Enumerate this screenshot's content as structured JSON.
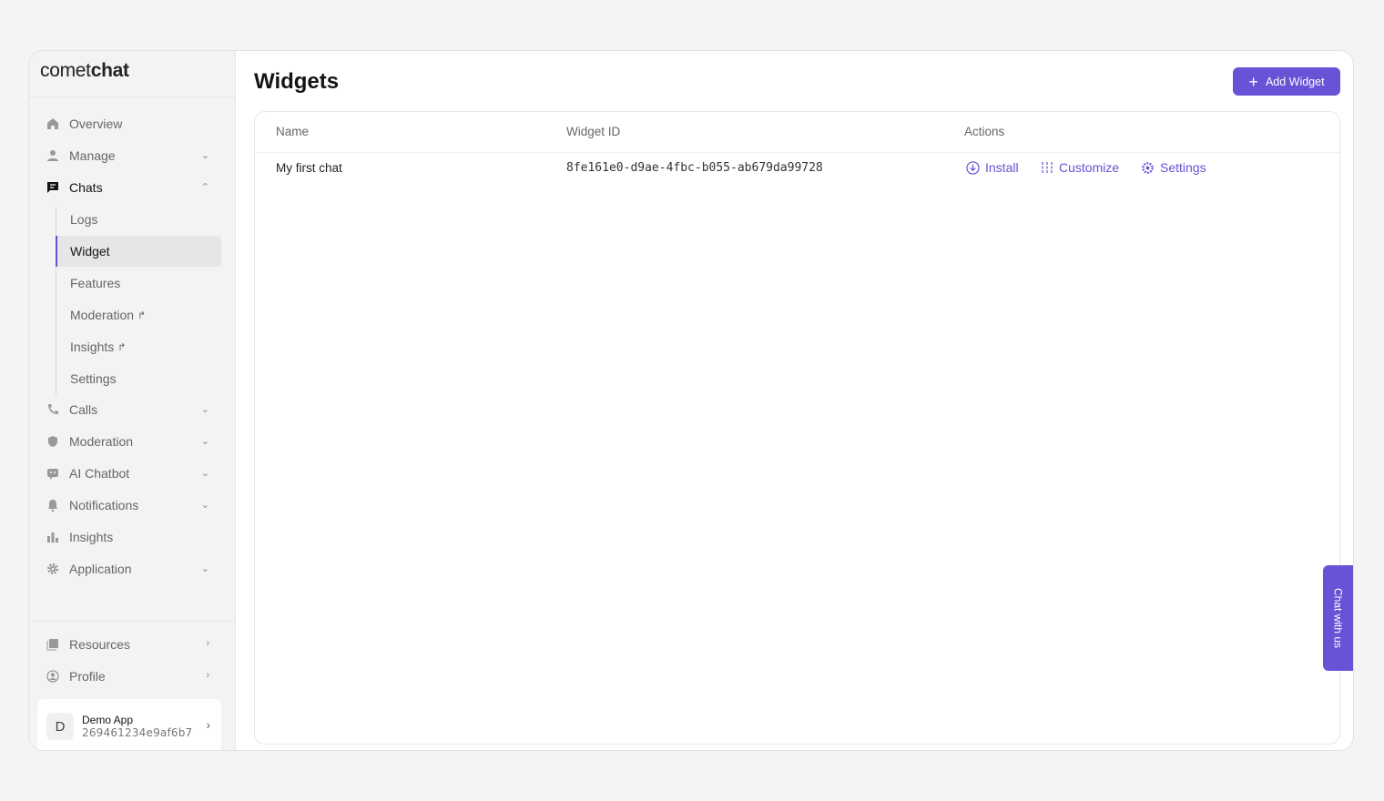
{
  "logo": {
    "light": "comet",
    "bold": "chat"
  },
  "sidebar": {
    "items": [
      {
        "label": "Overview",
        "icon": "home-icon"
      },
      {
        "label": "Manage",
        "icon": "user-icon"
      },
      {
        "label": "Chats",
        "icon": "chat-icon"
      },
      {
        "label": "Calls",
        "icon": "phone-icon"
      },
      {
        "label": "Moderation",
        "icon": "shield-icon"
      },
      {
        "label": "AI Chatbot",
        "icon": "bot-icon"
      },
      {
        "label": "Notifications",
        "icon": "bell-icon"
      },
      {
        "label": "Insights",
        "icon": "bar-chart-icon"
      },
      {
        "label": "Application",
        "icon": "gear-icon"
      }
    ],
    "sub_items": [
      "Logs",
      "Widget",
      "Features",
      "Moderation",
      "Insights",
      "Settings"
    ],
    "footer": [
      {
        "label": "Resources",
        "icon": "book-icon"
      },
      {
        "label": "Profile",
        "icon": "profile-icon"
      }
    ],
    "app": {
      "initial": "D",
      "name": "Demo App",
      "id": "269461234e9af6b7"
    }
  },
  "main": {
    "title": "Widgets",
    "add_button": "Add Widget",
    "columns": [
      "Name",
      "Widget ID",
      "Actions"
    ],
    "rows": [
      {
        "name": "My first chat",
        "id": "8fe161e0-d9ae-4fbc-b055-ab679da99728",
        "actions": [
          "Install",
          "Customize",
          "Settings"
        ]
      }
    ]
  },
  "chat_tab": "Chat with us",
  "colors": {
    "accent": "#6852d6"
  }
}
